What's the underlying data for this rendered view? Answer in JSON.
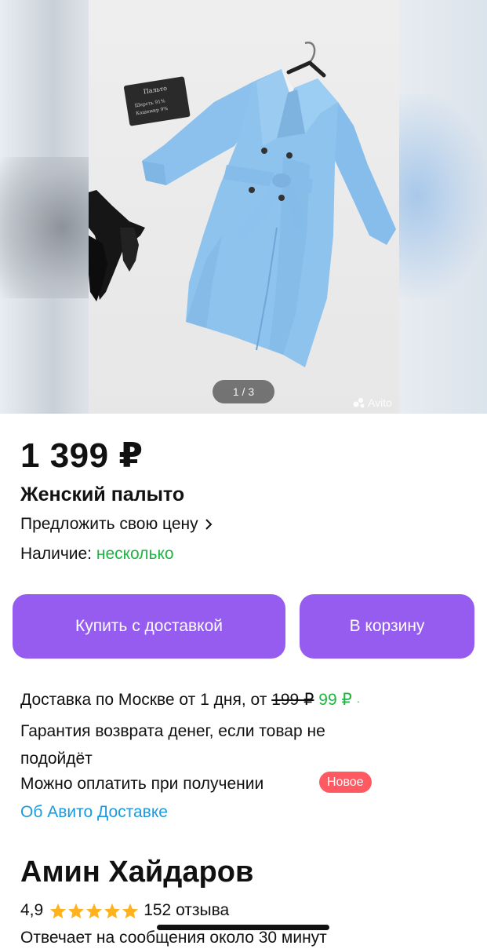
{
  "gallery": {
    "counter": "1 / 3",
    "watermark": "Avito",
    "label_card": {
      "title": "Пальто",
      "line1": "Шерсть  91%",
      "line2": "Кашемир  9%"
    }
  },
  "product": {
    "price": "1 399 ₽",
    "title": "Женский палыто",
    "offer_price": "Предложить свою цену",
    "availability_label": "Наличие:",
    "availability_value": "несколько"
  },
  "actions": {
    "buy_with_delivery": "Купить с доставкой",
    "add_to_cart": "В корзину"
  },
  "delivery": {
    "text": "Доставка по Москве от 1 дня, от",
    "old_price": "199 ₽",
    "new_price": "99 ₽",
    "separator": "·",
    "guarantee": "Гарантия возврата денег, если товар не подойдёт",
    "pay_on_receipt": "Можно оплатить при получении",
    "badge": "Новое",
    "about_link": "Об Авито Доставке"
  },
  "seller": {
    "name": "Амин Хайдаров",
    "rating": "4,9",
    "stars": 5,
    "reviews": "152 отзыва",
    "response_time": "Отвечает на сообщения около 30 минут"
  },
  "colors": {
    "accent": "#965cf0",
    "green": "#1eb543",
    "link": "#1a9be0",
    "badge": "#ff5a61",
    "star": "#ffb21e",
    "coat": "#8ec3ee"
  }
}
